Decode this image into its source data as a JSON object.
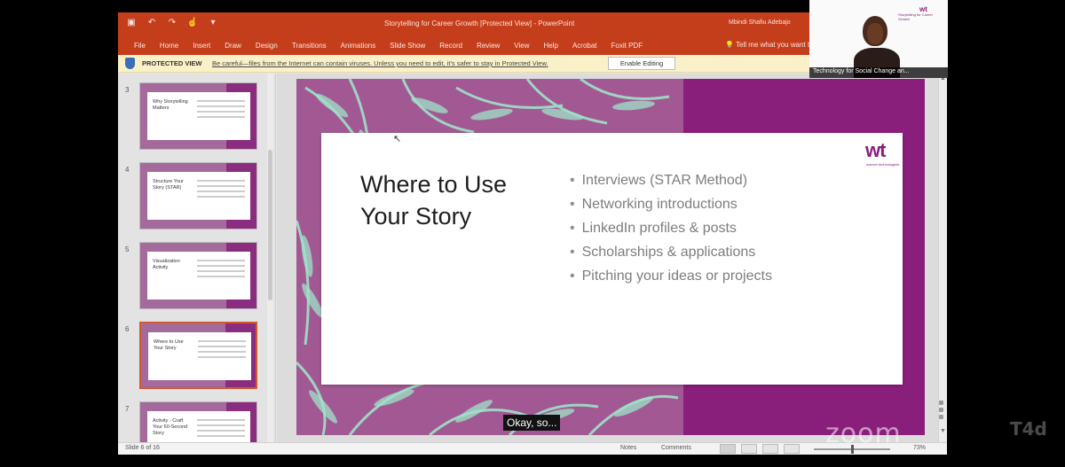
{
  "window": {
    "doc_title": "Storytelling for Career Growth [Protected View] - PowerPoint",
    "user": "Mbindi Shafiu Adebajo"
  },
  "quick_access": {
    "save": "save-icon",
    "undo": "undo-icon",
    "redo": "redo-icon"
  },
  "menu": [
    "File",
    "Home",
    "Insert",
    "Draw",
    "Design",
    "Transitions",
    "Animations",
    "Slide Show",
    "Record",
    "Review",
    "View",
    "Help",
    "Acrobat",
    "Foxit PDF"
  ],
  "tell_me": "Tell me what you want to do",
  "protected_view": {
    "label": "PROTECTED VIEW",
    "message": "Be careful—files from the Internet can contain viruses. Unless you need to edit, it's safer to stay in Protected View.",
    "enable_button": "Enable Editing"
  },
  "thumbnails": [
    {
      "num": "3",
      "title": "Why Storytelling Matters"
    },
    {
      "num": "4",
      "title": "Structure Your Story (STAR)"
    },
    {
      "num": "5",
      "title": "Visualization Activity"
    },
    {
      "num": "6",
      "title": "Where to Use Your Story"
    },
    {
      "num": "7",
      "title": "Activity - Craft Your 60-Second Story"
    }
  ],
  "slide": {
    "title": "Where to Use Your Story",
    "bullets": [
      "Interviews (STAR Method)",
      "Networking introductions",
      "LinkedIn profiles & posts",
      "Scholarships & applications",
      "Pitching your ideas or projects"
    ],
    "logo_text": "wt",
    "logo_sub": "women technologists"
  },
  "statusbar": {
    "slide_count": "Slide 6 of 16",
    "notes": "Notes",
    "comments": "Comments",
    "zoom": "73%"
  },
  "subtitle": "Okay, so...",
  "zoom_watermark": "zoom",
  "brand_watermark": "T4d",
  "camera": {
    "name": "Technology for Social Change an...",
    "bg_logo": "wt",
    "bg_text": "Storytelling for Career Growth"
  },
  "colors": {
    "accent": "#c43e1c",
    "slide_purple": "#8a1e7b",
    "slide_mauve": "#a25893",
    "leaf_green": "#9ee3c8"
  }
}
